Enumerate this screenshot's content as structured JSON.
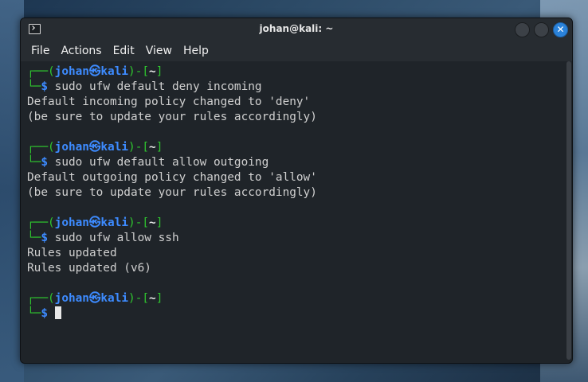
{
  "window": {
    "title": "johan@kali: ~",
    "close_glyph": "✕"
  },
  "menu": [
    "File",
    "Actions",
    "Edit",
    "View",
    "Help"
  ],
  "prompt": {
    "user": "johan",
    "at_symbol": "㉿",
    "host": "kali",
    "dir": "~",
    "dollar": "$"
  },
  "blocks": [
    {
      "command": "sudo ufw default deny incoming",
      "output": [
        "Default incoming policy changed to 'deny'",
        "(be sure to update your rules accordingly)"
      ]
    },
    {
      "command": "sudo ufw default allow outgoing",
      "output": [
        "Default outgoing policy changed to 'allow'",
        "(be sure to update your rules accordingly)"
      ]
    },
    {
      "command": "sudo ufw allow ssh",
      "output": [
        "Rules updated",
        "Rules updated (v6)"
      ]
    }
  ],
  "icons": {
    "app": "terminal-icon",
    "minimize": "minimize-icon",
    "maximize": "maximize-icon",
    "close": "close-icon"
  },
  "colors": {
    "prompt_green": "#2fc62f",
    "prompt_blue": "#3d8bff",
    "close_blue": "#2a82da",
    "terminal_bg": "#1f2429"
  }
}
